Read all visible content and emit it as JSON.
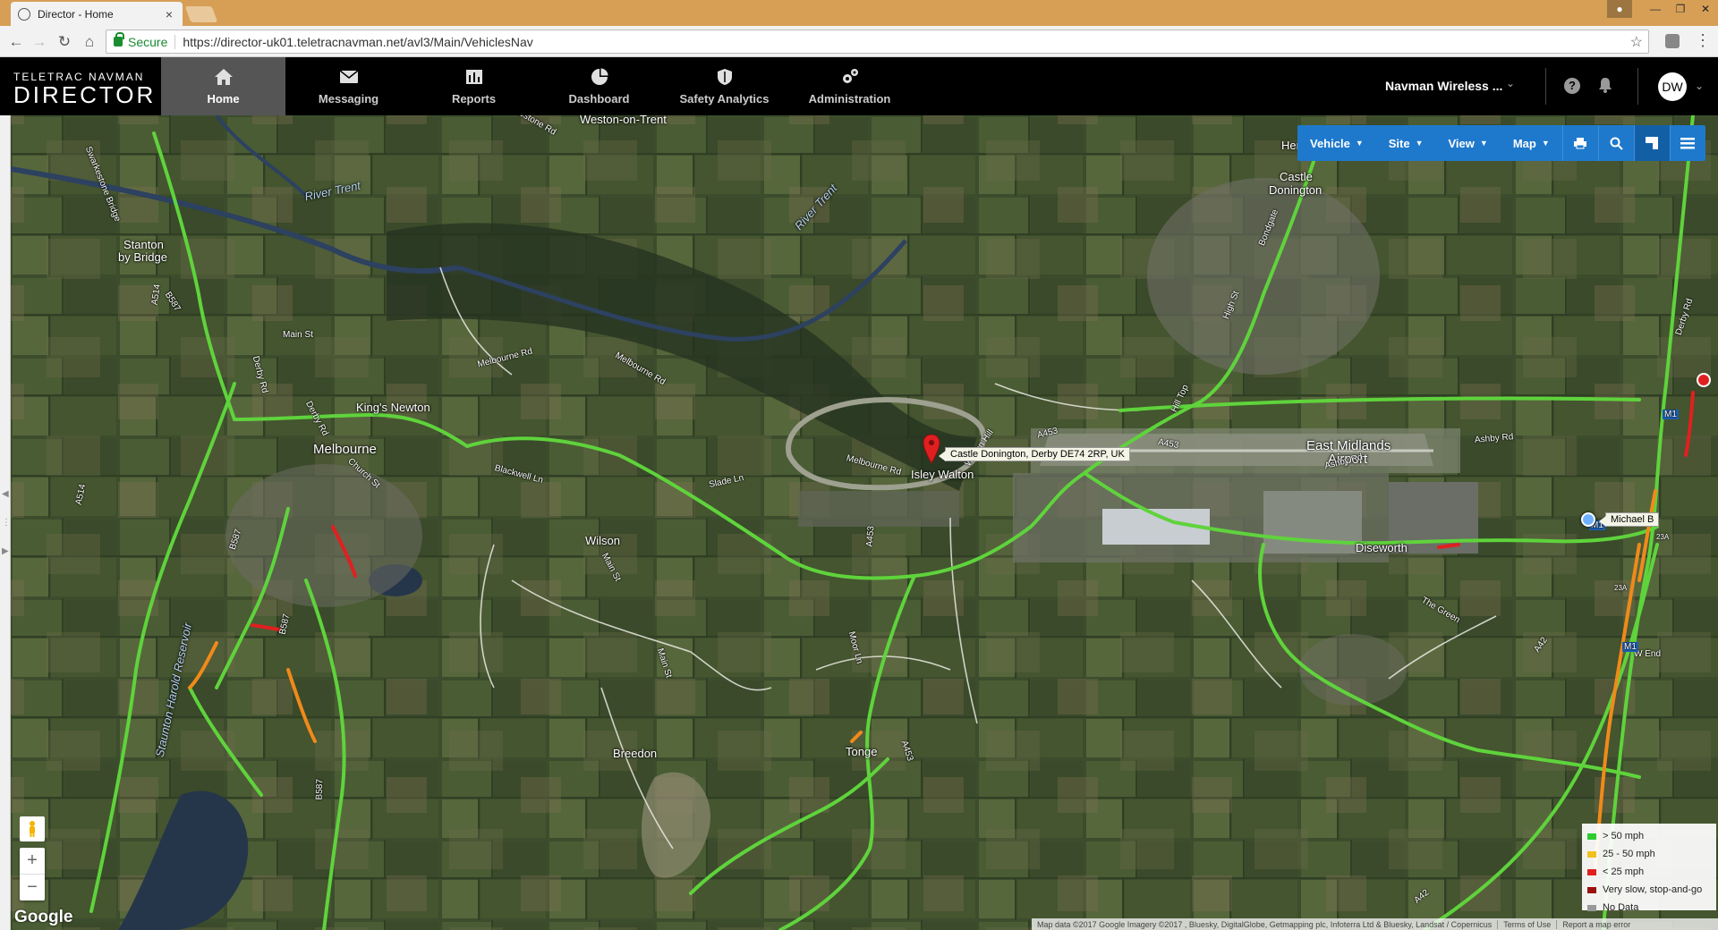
{
  "browser": {
    "tab_title": "Director - Home",
    "tab_close": "×",
    "secure_label": "Secure",
    "url": "https://director-uk01.teletracnavman.net/avl3/Main/VehiclesNav",
    "nav_icons": [
      "back-arrow-icon",
      "forward-arrow-icon",
      "reload-icon",
      "home-icon"
    ]
  },
  "brand": {
    "line1": "TELETRAC NAVMAN",
    "line2": "DIRECTOR"
  },
  "nav": {
    "home": "Home",
    "messaging": "Messaging",
    "reports": "Reports",
    "dashboard": "Dashboard",
    "safety": "Safety Analytics",
    "administration": "Administration"
  },
  "header": {
    "account": "Navman Wireless ...",
    "avatar_initials": "DW"
  },
  "map_controls": {
    "vehicle": "Vehicle",
    "site": "Site",
    "view": "View",
    "map": "Map"
  },
  "map": {
    "pin_label": "Castle Donington, Derby DE74 2RP, UK",
    "vehicle_label": "Michael B",
    "places": {
      "weston": "Weston-on-Trent",
      "castle_donington_1": "Castle",
      "castle_donington_2": "Donington",
      "stanton_1": "Stanton",
      "stanton_2": "by Bridge",
      "kings_newton": "King's Newton",
      "melbourne": "Melbourne",
      "isley_walton": "Isley Walton",
      "ema_1": "East Midlands",
      "ema_2": "Airport",
      "wilson": "Wilson",
      "diseworth": "Diseworth",
      "breedon": "Breedon",
      "tonge": "Tonge",
      "hemington": "Hemington"
    },
    "water": {
      "river_trent_1": "River Trent",
      "river_trent_2": "River Trent",
      "staunton_harold": "Staunton Harold Reservoir"
    },
    "roads": {
      "swarkestone_rd": "Swarkestone Rd",
      "swarkestone_bridge": "Swarkestone Bridge",
      "a514_1": "A514",
      "b587_1": "B587",
      "main_st_1": "Main St",
      "derby_rd_1": "Derby Rd",
      "derby_rd_2": "Derby Rd",
      "a514_2": "A514",
      "b587_2": "B587",
      "church_st": "Church St",
      "b587_3": "B587",
      "b587_4": "B587",
      "melbourne_rd_1": "Melbourne Rd",
      "melbourne_rd_2": "Melbourne Rd",
      "melbourne_rd_3": "Melbourne Rd",
      "blackwell_ln": "Blackwell Ln",
      "slade_ln": "Slade Ln",
      "main_st_2": "Main St",
      "main_st_3": "Main St",
      "a453_1": "A453",
      "a453_2": "A453",
      "a453_3": "A453",
      "a453_4": "A453",
      "walton_hill": "Walton Hill",
      "moor_ln": "Moor Ln",
      "ashby_rd_1": "Ashby Rd",
      "ashby_rd_2": "Ashby Rd",
      "hill_top": "Hill Top",
      "high_st": "High St",
      "bondgate": "Bondgate",
      "the_green": "The Green",
      "a42_1": "A42",
      "a42_2": "A42",
      "w_end": "W End",
      "m1_1": "M1",
      "m1_2": "M1",
      "m1_3": "M1",
      "j23a_1": "23A",
      "j23a_2": "23A",
      "derby_rd_3": "Derby Rd"
    },
    "google": "Google",
    "zoom_in": "+",
    "zoom_out": "−"
  },
  "legend": [
    {
      "label": "> 50 mph",
      "color": "#2ecc2e"
    },
    {
      "label": "25 - 50 mph",
      "color": "#f0c020"
    },
    {
      "label": "< 25 mph",
      "color": "#e02020"
    },
    {
      "label": "Very slow, stop-and-go",
      "color": "#9b1010"
    },
    {
      "label": "No Data",
      "color": "#999999"
    }
  ],
  "attribution": {
    "data": "Map data ©2017 Google Imagery ©2017 , Bluesky, DigitalGlobe, Getmapping plc, Infoterra Ltd & Bluesky, Landsat / Copernicus",
    "terms": "Terms of Use",
    "report": "Report a map error"
  },
  "colors": {
    "accent_blue": "#1e79cc",
    "traffic_green": "#5fd33c",
    "traffic_orange": "#f08a1a",
    "traffic_red": "#e02020"
  }
}
